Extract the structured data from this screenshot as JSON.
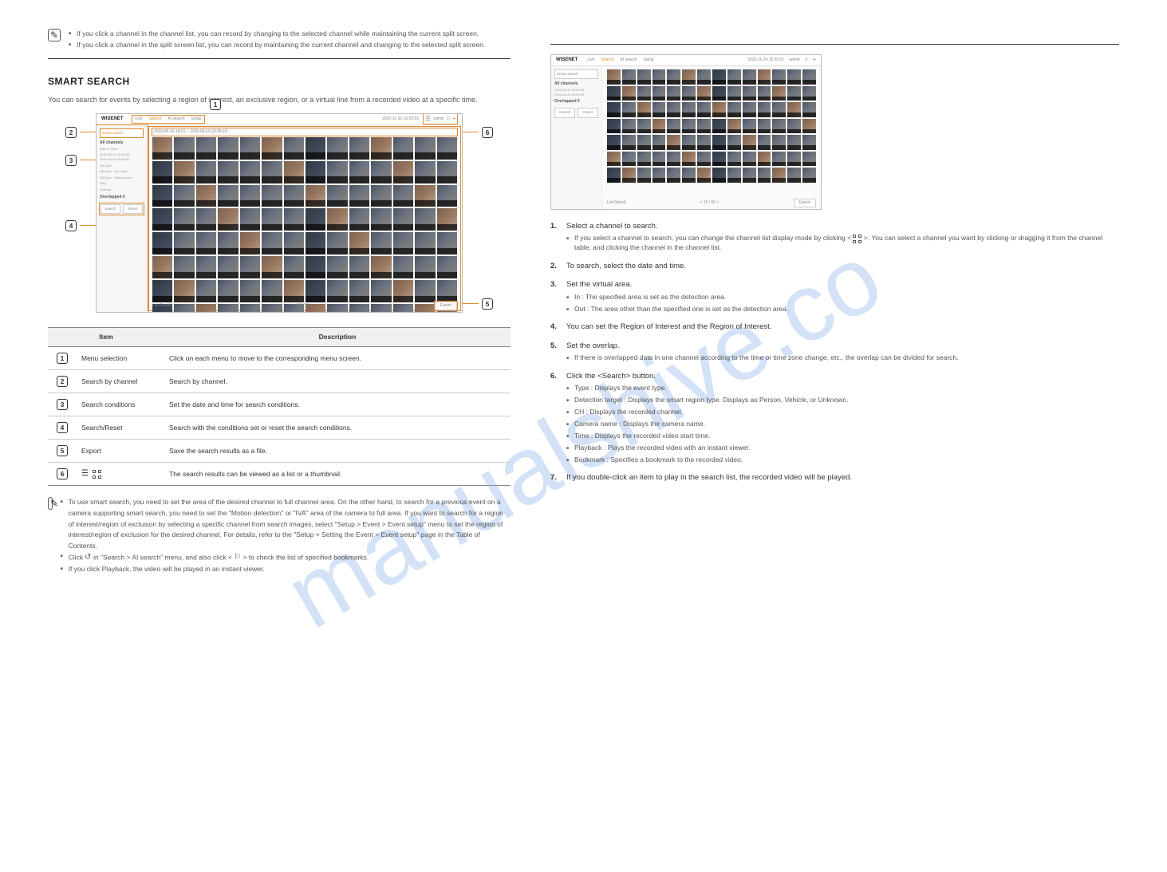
{
  "watermark": "manualshive.co",
  "left": {
    "top_notes": [
      "If you click a channel in the channel list, you can record by changing to the selected channel while maintaining the current split screen.",
      "If you click a channel in the split screen list, you can record by maintaining the current channel and changing to the selected split screen."
    ],
    "divider": true,
    "section_title": "SMART SEARCH",
    "section_desc": "You can search for events by selecting a region of interest, an exclusive region, or a virtual line from a recorded video at a specific time.",
    "callouts": [
      "1",
      "2",
      "3",
      "4",
      "5",
      "6"
    ],
    "screenshot": {
      "logo": "WISENET",
      "nav": [
        "Live",
        "Search",
        "AI search",
        "Setup"
      ],
      "nav_active": "Search",
      "header_time": "2020-11-30 16:29:03",
      "header_user": "admin",
      "sidebar": {
        "tab": "Smart search",
        "channel_lbl": "All channels",
        "time_lbl": "Date & Time",
        "time_val": "2020-06-19 18:00:00 ~\n2020-06-20 05:59:59",
        "objtypelbl": "ObjType",
        "objtype1": "ObjType : Top color",
        "objtype2": "ObjType : Bottom color",
        "flag": "Flag",
        "overlap": "Overlap",
        "overlap_val": "Overlapped 0",
        "btn_search": "Search",
        "btn_reset": "Reset"
      },
      "date_range": "2020-06-19 18:01 ~ 2020-06-19 23:38:19",
      "footer_label": "List Result",
      "pager": "< 10 / 50 >",
      "export": "Export"
    },
    "table": {
      "head": [
        "Item",
        "Description"
      ],
      "rows": [
        {
          "n": "1",
          "item": "Menu selection",
          "desc": "Click on each menu to move to the corresponding menu screen."
        },
        {
          "n": "2",
          "item": "Search by channel",
          "desc": "Search by channel."
        },
        {
          "n": "3",
          "item": "Search conditions",
          "desc": "Set the date and time for search conditions."
        },
        {
          "n": "4",
          "item": "Search/Reset",
          "desc": "Search with the conditions set or reset the search conditions."
        },
        {
          "n": "5",
          "item": "Export",
          "desc": "Save the search results as a file."
        },
        {
          "n": "6",
          "item_icon": "icons",
          "desc": "The search results can be viewed as a list or a thumbnail."
        }
      ]
    },
    "bottom_notes": [
      {
        "text": "To use smart search, you need to set the area of the desired channel to full channel area. On the other hand, to search for a previous event on a camera supporting smart search, you need to set the \"Motion detection\" or \"IVA\" area of the camera to full area. If you want to search for a region of interest/region of exclusion by selecting a specific channel from search images, select \"Setup > Event > Event setup\" menu to set the region of interest/region of exclusion for the desired channel.",
        "ref": " For details, refer to the \"Setup > Setting the Event > Event setup\" page in the Table of Contents."
      },
      {
        "text": "Click ",
        "icon1": "instant",
        "mid": " in \"Search > AI search\" menu, and also click < ",
        "icon2": "bookmark",
        "end": " > to check the list of specified bookmarks."
      },
      {
        "text": "If you click Playback, the video will be played in an instant viewer."
      }
    ]
  },
  "right": {
    "steps": [
      {
        "n": "1.",
        "text": "Select a channel to search.",
        "sub": "If you select a channel to search, you can change the channel list display mode by clicking < ",
        "icon": "thumb",
        "sub_end": " >. You can select a channel you want by clicking or dragging it from the channel table, and clicking the channel in the channel list."
      },
      {
        "n": "2.",
        "text": "To search, select the date and time."
      },
      {
        "n": "3.",
        "text": "Set the virtual area.",
        "sub_items": [
          "In : The specified area is set as the detection area.",
          "Out : The area other than the specified one is set as the detection area."
        ]
      },
      {
        "n": "4.",
        "text": "You can set the Region of Interest and the Region of Interest."
      },
      {
        "n": "5.",
        "text": "Set the overlap.",
        "sub": "If there is overlapped data in one channel according to the time or time zone change, etc., the overlap can be divided for search."
      },
      {
        "n": "6.",
        "text": "Click the <Search> button.",
        "sub_items": [
          "Type : Displays the event type.",
          "Detection target : Displays the smart region type. Displays as Person, Vehicle, or Unknown.",
          "CH : Displays the recorded channel.",
          "Camera name : Displays the camera name.",
          "Time : Displays the recorded video start time.",
          "Playback : Plays the recorded video with an instant viewer.",
          "Bookmark : Specifies a bookmark to the recorded video."
        ]
      },
      {
        "n": "7.",
        "text": "If you double-click an item to play in the search list, the recorded video will be played."
      }
    ],
    "small_screenshot": {
      "logo": "WISENET",
      "nav": [
        "Live",
        "Search",
        "AI search",
        "Setup"
      ],
      "header_time": "2020-11-24 15:30:01",
      "sidebar_tab": "Smart search",
      "channel_lbl": "All channels",
      "time_val": "2020-06-19 18:00:00 ~\n2020-06-20 05:59:59",
      "overlap_val": "Overlapped 0",
      "btn_search": "Search",
      "btn_reset": "Reset",
      "footer_label": "List Result",
      "pager": "< 10 / 50 >",
      "export": "Export"
    }
  }
}
